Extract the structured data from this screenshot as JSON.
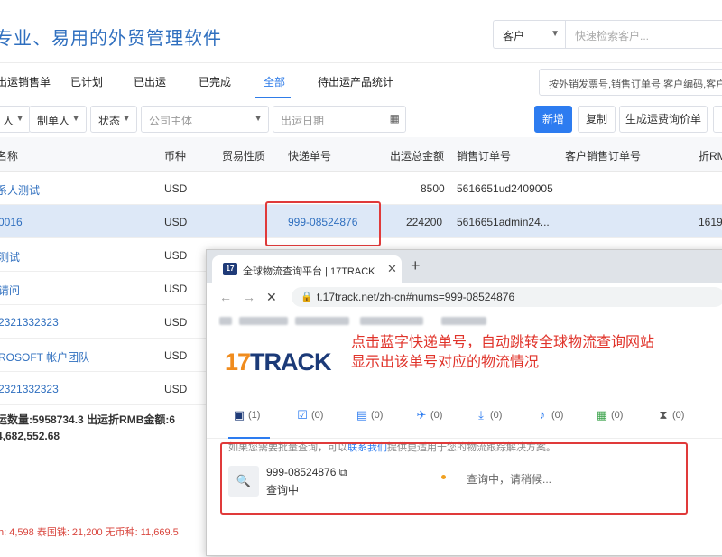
{
  "header": {
    "slogan": "专业、易用的外贸管理软件",
    "search_type": "客户",
    "search_placeholder": "快速检索客户..."
  },
  "tabs": [
    {
      "label": "出运销售单"
    },
    {
      "label": "已计划"
    },
    {
      "label": "已出运"
    },
    {
      "label": "已完成"
    },
    {
      "label": "全部",
      "active": true
    },
    {
      "label": "待出运产品统计"
    }
  ],
  "order_search_placeholder": "按外销发票号,销售订单号,客户编码,客户",
  "filters": {
    "f1": "人",
    "f2": "制单人",
    "f3": "状态",
    "company_placeholder": "公司主体",
    "date_placeholder": "出运日期",
    "btn_new": "新增",
    "btn_copy": "复制",
    "btn_quote": "生成运费询价单"
  },
  "table": {
    "headers": [
      "名称",
      "币种",
      "贸易性质",
      "快递单号",
      "出运总金额",
      "销售订单号",
      "客户销售订单号",
      "折RM"
    ],
    "rows": [
      {
        "name": "系人测试",
        "currency": "USD",
        "tracking": "",
        "amount": "8500",
        "order": "5616651ud2409005",
        "rmb": ""
      },
      {
        "name": "0016",
        "currency": "USD",
        "tracking": "999-08524876",
        "amount": "224200",
        "order": "5616651admin24...",
        "rmb": "1619"
      },
      {
        "name": "测试",
        "currency": "USD"
      },
      {
        "name": "请问",
        "currency": "USD"
      },
      {
        "name": "2321332323",
        "currency": "USD"
      },
      {
        "name": "ROSOFT 帐户团队",
        "currency": "USD"
      },
      {
        "name": "2321332323",
        "currency": "USD"
      }
    ]
  },
  "summary": {
    "line1": "运数量:5958734.3   出运折RMB金额:6",
    "line2": "4,682,552.68"
  },
  "footer_totals": "h: 4,598  泰国铢: 21,200  无币种: 11,669.5",
  "browser": {
    "tab_title": "全球物流查询平台 | 17TRACK",
    "favicon": "17",
    "url": "t.17track.net/zh-cn#nums=999-08524876",
    "logo_num": "17",
    "logo_text": "TRACK",
    "annotation_line1": "点击蓝字快递单号，自动跳转全球物流查询网站",
    "annotation_line2": "显示出该单号对应的物流情况",
    "carriers": [
      {
        "icon": "package-icon",
        "count": "(1)"
      },
      {
        "icon": "checklist-icon",
        "count": "(0)"
      },
      {
        "icon": "box-icon",
        "count": "(0)"
      },
      {
        "icon": "plane-icon",
        "count": "(0)"
      },
      {
        "icon": "landing-icon",
        "count": "(0)"
      },
      {
        "icon": "bell-icon",
        "count": "(0)"
      },
      {
        "icon": "cash-icon",
        "count": "(0)"
      },
      {
        "icon": "hourglass-icon",
        "count": "(0)"
      }
    ],
    "hint_before": "如果您需要批量查询，可以",
    "hint_contact": "联系我们",
    "hint_after": "提供更适用于您的物流跟踪解决方案。",
    "result_number": "999-08524876",
    "result_status": "查询中",
    "result_message": "查询中，请稍候..."
  },
  "colors": {
    "accent": "#2d7cf0",
    "annotation_red": "#e0332a",
    "selected_row": "#dde8f7"
  }
}
